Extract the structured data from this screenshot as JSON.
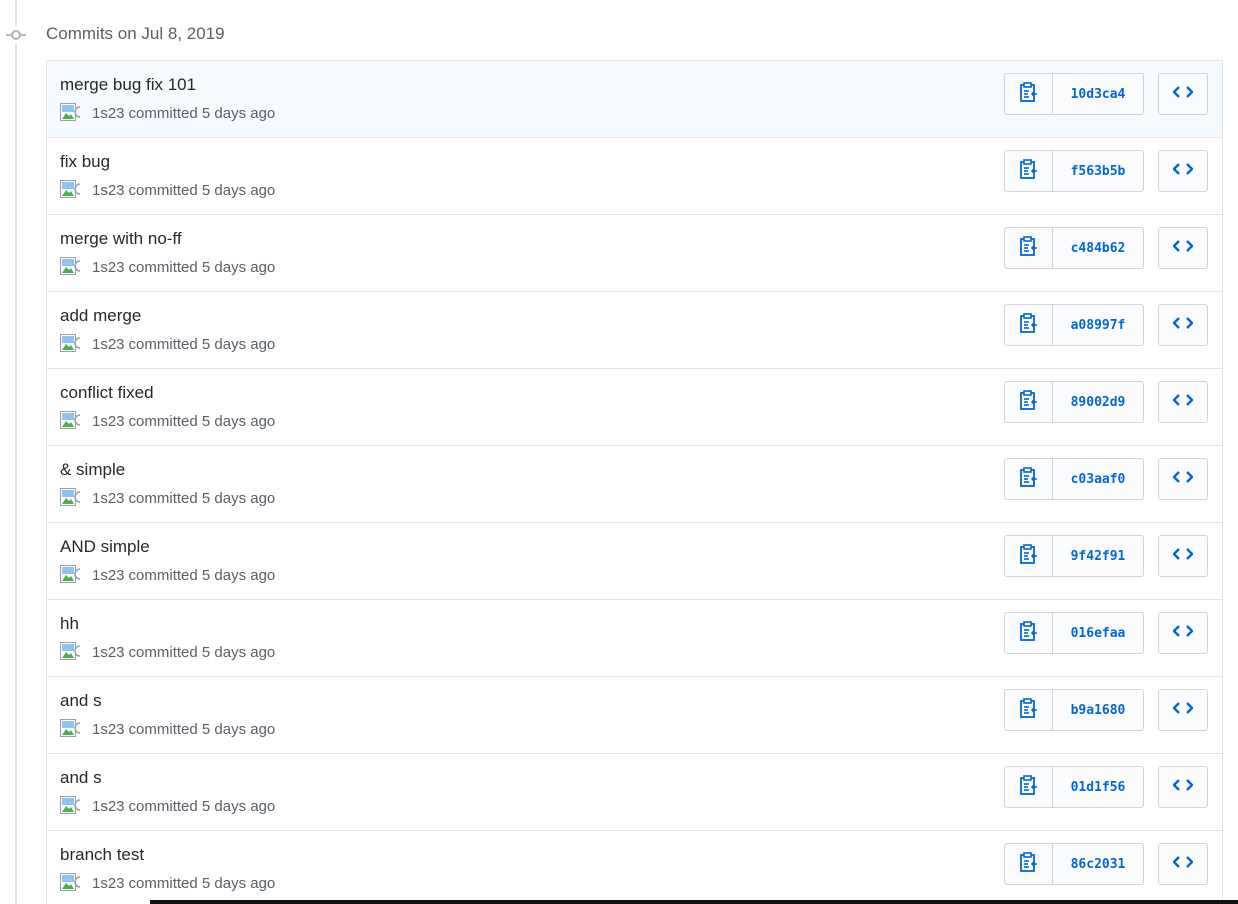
{
  "group": {
    "title": "Commits on Jul 8, 2019",
    "icon": "git-commit-icon"
  },
  "colors": {
    "link": "#0366d6",
    "muted": "#586069",
    "border": "#e1e4e8",
    "highlight_row": "#f6fbff"
  },
  "commit_meta_suffix": "committed 5 days ago",
  "commits": [
    {
      "title": "merge bug fix 101",
      "author": "1s23",
      "meta": "committed 5 days ago",
      "sha": "10d3ca4"
    },
    {
      "title": "fix bug",
      "author": "1s23",
      "meta": "committed 5 days ago",
      "sha": "f563b5b"
    },
    {
      "title": "merge with no-ff",
      "author": "1s23",
      "meta": "committed 5 days ago",
      "sha": "c484b62"
    },
    {
      "title": "add merge",
      "author": "1s23",
      "meta": "committed 5 days ago",
      "sha": "a08997f"
    },
    {
      "title": "conflict fixed",
      "author": "1s23",
      "meta": "committed 5 days ago",
      "sha": "89002d9"
    },
    {
      "title": "& simple",
      "author": "1s23",
      "meta": "committed 5 days ago",
      "sha": "c03aaf0"
    },
    {
      "title": "AND simple",
      "author": "1s23",
      "meta": "committed 5 days ago",
      "sha": "9f42f91"
    },
    {
      "title": "hh",
      "author": "1s23",
      "meta": "committed 5 days ago",
      "sha": "016efaa"
    },
    {
      "title": "and s",
      "author": "1s23",
      "meta": "committed 5 days ago",
      "sha": "b9a1680"
    },
    {
      "title": "and s",
      "author": "1s23",
      "meta": "committed 5 days ago",
      "sha": "01d1f56"
    },
    {
      "title": "branch test",
      "author": "1s23",
      "meta": "committed 5 days ago",
      "sha": "86c2031"
    }
  ],
  "icons": {
    "copy": "clipboard-icon",
    "browse": "code-icon",
    "avatar": "broken-image-icon"
  }
}
